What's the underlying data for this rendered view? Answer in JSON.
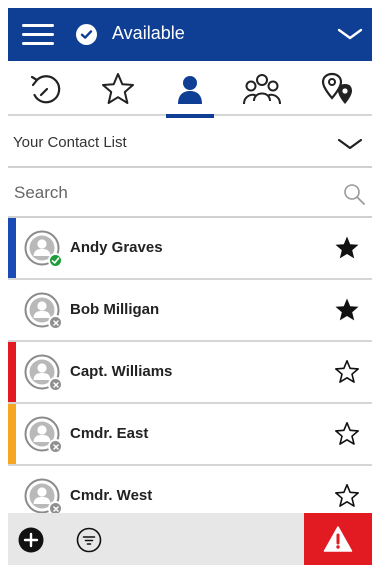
{
  "header": {
    "status_label": "Available",
    "menu_icon": "hamburger-menu-icon",
    "status_icon": "check-circle-icon",
    "expand_icon": "chevron-down-icon",
    "background_color": "#0e3f95"
  },
  "tabs": [
    {
      "name": "recent",
      "icon": "history-icon",
      "active": false
    },
    {
      "name": "favorites",
      "icon": "star-outline-icon",
      "active": false
    },
    {
      "name": "contacts",
      "icon": "person-icon",
      "active": true
    },
    {
      "name": "groups",
      "icon": "group-icon",
      "active": false
    },
    {
      "name": "locations",
      "icon": "map-pins-icon",
      "active": false
    }
  ],
  "list_selector": {
    "label": "Your Contact List",
    "icon": "chevron-down-icon"
  },
  "search": {
    "placeholder": "Search",
    "value": "",
    "icon": "search-icon"
  },
  "contacts": [
    {
      "name": "Andy Graves",
      "presence": "online",
      "favorite": true,
      "stripe_color": "#1a4bb4"
    },
    {
      "name": "Bob Milligan",
      "presence": "offline",
      "favorite": true,
      "stripe_color": ""
    },
    {
      "name": "Capt. Williams",
      "presence": "offline",
      "favorite": false,
      "stripe_color": "#e21b23"
    },
    {
      "name": "Cmdr. East",
      "presence": "offline",
      "favorite": false,
      "stripe_color": "#f5a623"
    },
    {
      "name": "Cmdr. West",
      "presence": "offline",
      "favorite": false,
      "stripe_color": ""
    }
  ],
  "bottom_bar": {
    "add_icon": "plus-circle-icon",
    "filter_icon": "filter-icon",
    "alert_icon": "warning-triangle-icon",
    "alert_color": "#e21b23"
  }
}
